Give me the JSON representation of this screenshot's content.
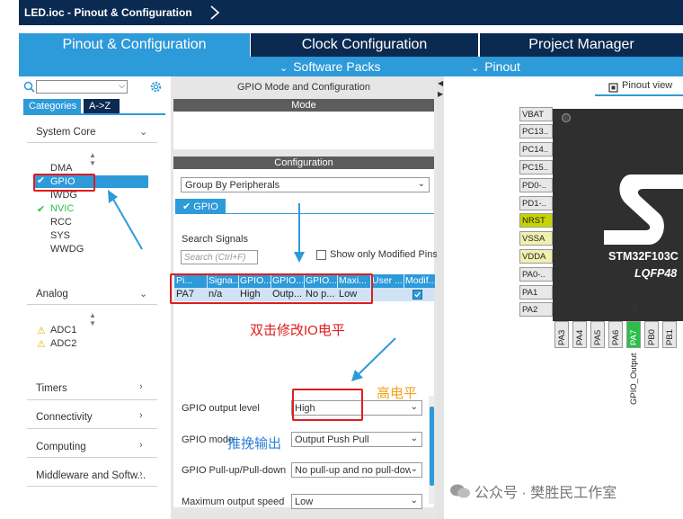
{
  "title": "LED.ioc - Pinout & Configuration",
  "main_tabs": [
    "Pinout & Configuration",
    "Clock Configuration",
    "Project Manager"
  ],
  "sub_menu": [
    "Software Packs",
    "Pinout"
  ],
  "left": {
    "category_tabs": [
      "Categories",
      "A->Z"
    ],
    "sections": {
      "system_core": "System Core",
      "analog": "Analog",
      "timers": "Timers",
      "connectivity": "Connectivity",
      "computing": "Computing",
      "middleware": "Middleware and Softw..."
    },
    "system_core_items": [
      "DMA",
      "GPIO",
      "IWDG",
      "NVIC",
      "RCC",
      "SYS",
      "WWDG"
    ],
    "analog_items": [
      "ADC1",
      "ADC2"
    ]
  },
  "middle": {
    "title": "GPIO Mode and Configuration",
    "mode_header": "Mode",
    "config_header": "Configuration",
    "group_select": "Group By Peripherals",
    "gpio_tab": "GPIO",
    "search_label": "Search Signals",
    "search_placeholder": "Search (Ctrl+F)",
    "show_modified_label": "Show only Modified Pins",
    "table": {
      "headers": [
        "Pi...",
        "Signa...",
        "GPIO...",
        "GPIO...",
        "GPIO...",
        "Maxi...",
        "User ...",
        "Modif..."
      ],
      "row": [
        "PA7",
        "n/a",
        "High",
        "Outp...",
        "No p...",
        "Low"
      ]
    },
    "config_fields": [
      {
        "label": "GPIO output level",
        "value": "High"
      },
      {
        "label": "GPIO mode",
        "value": "Output Push Pull"
      },
      {
        "label": "GPIO Pull-up/Pull-down",
        "value": "No pull-up and no pull-down"
      },
      {
        "label": "Maximum output speed",
        "value": "Low"
      }
    ]
  },
  "right": {
    "pinout_view": "Pinout view",
    "chip_name": "STM32F103C",
    "chip_package": "LQFP48",
    "left_pins": [
      "VBAT",
      "PC13..",
      "PC14..",
      "PC15..",
      "PD0-..",
      "PD1-..",
      "NRST",
      "VSSA",
      "VDDA",
      "PA0-..",
      "PA1",
      "PA2"
    ],
    "bottom_pins": [
      "PA3",
      "PA4",
      "PA5",
      "PA6",
      "PA7",
      "PB0",
      "PB1"
    ],
    "pa7_label": "GPIO_Output"
  },
  "annotations": {
    "double_click": "双击修改IO电平",
    "high_level": "高电平",
    "push_pull": "推挽输出"
  },
  "watermark": "公众号 · 樊胜民工作室",
  "colors": {
    "accent": "#2d9ad9",
    "dark": "#0b2a52",
    "annotation_red": "#e01c1c",
    "pin_green": "#2bbf4a",
    "pin_olive": "#c8d400"
  }
}
